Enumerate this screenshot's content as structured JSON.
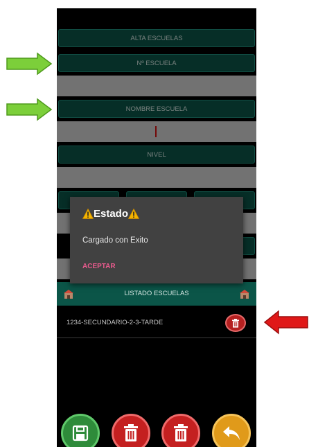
{
  "form": {
    "alta_label": "ALTA ESCUELAS",
    "numero_label": "Nº ESCUELA",
    "nombre_label": "NOMBRE ESCUELA",
    "nivel_label": "NIVEL"
  },
  "dialog": {
    "title": "Estado",
    "message": "Cargado con Exito",
    "accept_label": "ACEPTAR"
  },
  "list": {
    "header": "LISTADO ESCUELAS",
    "items": [
      {
        "label": "1234-SECUNDARIO-2-3-TARDE"
      }
    ]
  },
  "icons": {
    "warning": "warning-icon",
    "save": "save-icon",
    "delete": "trash-icon",
    "back": "back-arrow-icon",
    "list_header": "school-icon"
  },
  "colors": {
    "bar_green": "#0b5548",
    "accept_pink": "#e65a8c",
    "field_gray": "#cfcfcf",
    "annotation_green": "#7ccf3a",
    "annotation_red": "#e01818"
  }
}
